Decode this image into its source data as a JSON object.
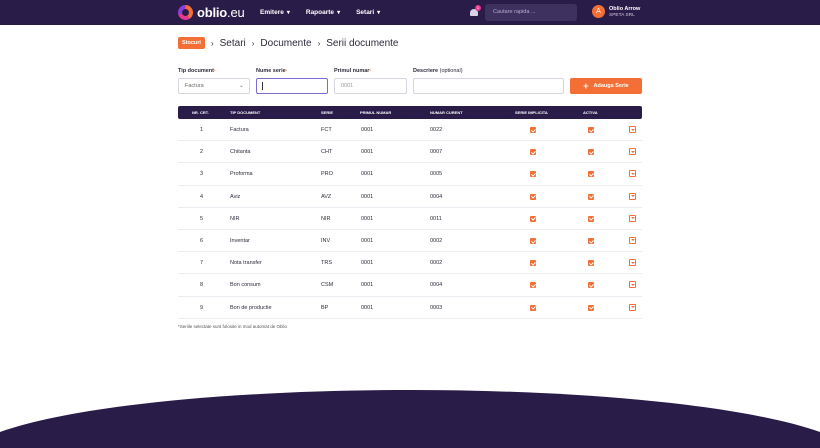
{
  "nav": {
    "logo_main": "oblio",
    "logo_tld": ".eu",
    "items": [
      {
        "label": "Emitere"
      },
      {
        "label": "Rapoarte"
      },
      {
        "label": "Setari"
      }
    ],
    "notification_count": "1",
    "search_placeholder": "Cautare rapida ...",
    "user_initial": "A",
    "user_name": "Oblio Arrow",
    "user_company": "SPETA SRL"
  },
  "breadcrumb": {
    "badge": "Stocuri",
    "items": [
      "Setari",
      "Documente",
      "Serii documente"
    ]
  },
  "form": {
    "tip_label": "Tip document",
    "tip_value": "Factura",
    "nume_label": "Nume serie",
    "nume_value": "",
    "primul_label": "Primul numar",
    "primul_placeholder": "0001",
    "descriere_label": "Descriere",
    "descriere_optional": "(optional)",
    "descriere_value": "",
    "add_button": "Adauga Serie"
  },
  "table": {
    "headers": {
      "nr": "NR. CRT.",
      "tip": "TIP DOCUMENT",
      "serie": "SERIE",
      "primul": "PRIMUL NUMAR",
      "curent": "NUMAR CURENT",
      "implicita": "SERIE IMPLICITA",
      "activa": "ACTIVA"
    },
    "rows": [
      {
        "nr": "1",
        "tip": "Factura",
        "serie": "FCT",
        "primul": "0001",
        "curent": "0022",
        "implicita": true,
        "activa": true
      },
      {
        "nr": "2",
        "tip": "Chitanta",
        "serie": "CHT",
        "primul": "0001",
        "curent": "0007",
        "implicita": true,
        "activa": true
      },
      {
        "nr": "3",
        "tip": "Proforma",
        "serie": "PRO",
        "primul": "0001",
        "curent": "0005",
        "implicita": true,
        "activa": true
      },
      {
        "nr": "4",
        "tip": "Aviz",
        "serie": "AVZ",
        "primul": "0001",
        "curent": "0004",
        "implicita": true,
        "activa": true
      },
      {
        "nr": "5",
        "tip": "NIR",
        "serie": "NIR",
        "primul": "0001",
        "curent": "0011",
        "implicita": true,
        "activa": true
      },
      {
        "nr": "6",
        "tip": "Inventar",
        "serie": "INV",
        "primul": "0001",
        "curent": "0002",
        "implicita": true,
        "activa": true
      },
      {
        "nr": "7",
        "tip": "Nota transfer",
        "serie": "TRS",
        "primul": "0001",
        "curent": "0002",
        "implicita": true,
        "activa": true
      },
      {
        "nr": "8",
        "tip": "Bon consum",
        "serie": "CSM",
        "primul": "0001",
        "curent": "0004",
        "implicita": true,
        "activa": true
      },
      {
        "nr": "9",
        "tip": "Bon de productie",
        "serie": "BP",
        "primul": "0001",
        "curent": "0003",
        "implicita": true,
        "activa": true
      }
    ]
  },
  "footnote": "*Seriile selectate sunt folosite in mod automat de Oblio",
  "colors": {
    "navbar": "#2a1c48",
    "accent": "#f36f35"
  }
}
